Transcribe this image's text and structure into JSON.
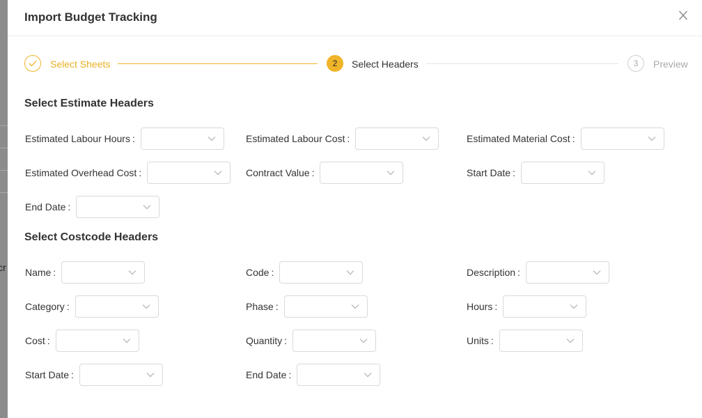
{
  "modal": {
    "title": "Import Budget Tracking"
  },
  "steps": [
    {
      "label": "Select Sheets",
      "number": "",
      "state": "done"
    },
    {
      "label": "Select Headers",
      "number": "2",
      "state": "active"
    },
    {
      "label": "Preview",
      "number": "3",
      "state": "pending"
    }
  ],
  "estimate_section": {
    "title": "Select Estimate Headers",
    "fields": [
      {
        "label": "Estimated Labour Hours",
        "value": ""
      },
      {
        "label": "Estimated Labour Cost",
        "value": ""
      },
      {
        "label": "Estimated Material Cost",
        "value": ""
      },
      {
        "label": "Estimated Overhead Cost",
        "value": ""
      },
      {
        "label": "Contract Value",
        "value": ""
      },
      {
        "label": "Start Date",
        "value": ""
      },
      {
        "label": "End Date",
        "value": ""
      }
    ]
  },
  "costcode_section": {
    "title": "Select Costcode Headers",
    "fields": [
      {
        "label": "Name",
        "value": ""
      },
      {
        "label": "Code",
        "value": ""
      },
      {
        "label": "Description",
        "value": ""
      },
      {
        "label": "Category",
        "value": ""
      },
      {
        "label": "Phase",
        "value": ""
      },
      {
        "label": "Hours",
        "value": ""
      },
      {
        "label": "Cost",
        "value": ""
      },
      {
        "label": "Quantity",
        "value": ""
      },
      {
        "label": "Units",
        "value": ""
      },
      {
        "label": "Start Date",
        "value": ""
      },
      {
        "label": "End Date",
        "value": ""
      }
    ]
  },
  "background": {
    "fragment_text": "cr"
  },
  "colors": {
    "accent": "#f0b429",
    "accent_text": "#e9b024",
    "muted": "#aaaaaa",
    "border": "#d9d9d9"
  },
  "icons": {
    "close": "close-icon",
    "check": "check-icon",
    "dropdown": "chevron-down-icon"
  }
}
